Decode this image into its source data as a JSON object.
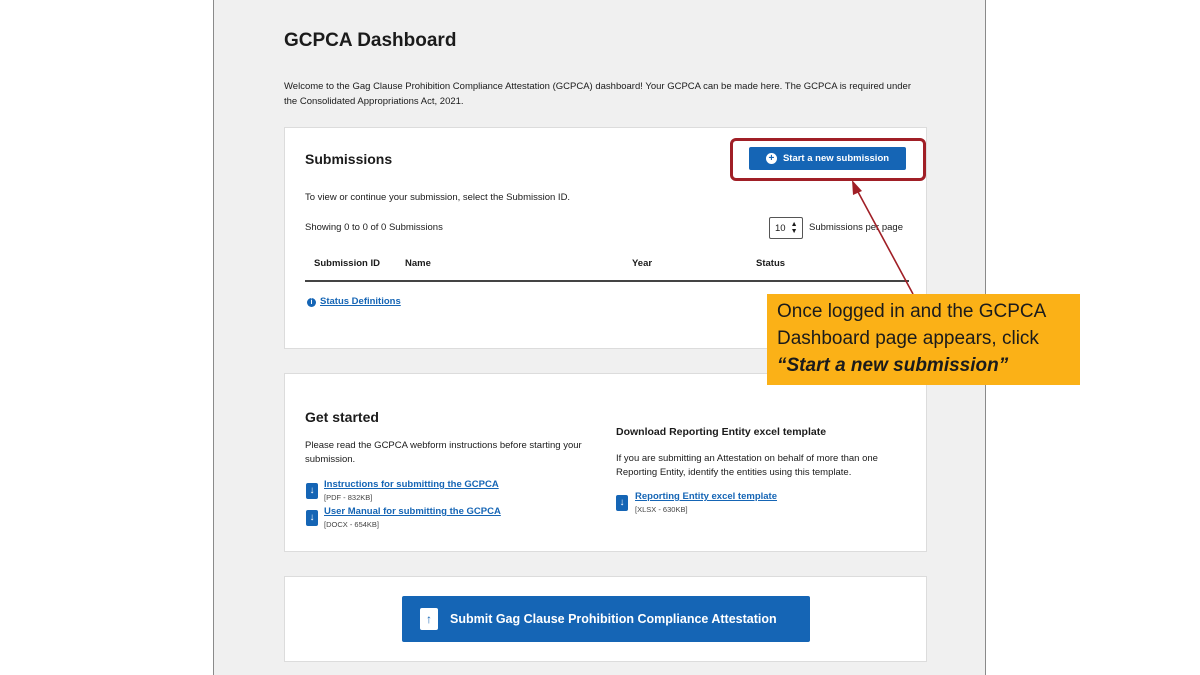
{
  "dashboard": {
    "title": "GCPCA Dashboard",
    "intro": "Welcome to the Gag Clause Prohibition Compliance Attestation (GCPCA) dashboard! Your GCPCA can be made here. The GCPCA is required under the Consolidated Appropriations Act, 2021."
  },
  "submissions": {
    "heading": "Submissions",
    "new_button": "Start a new submission",
    "instruction": "To view or continue your submission, select the Submission ID.",
    "showing": "Showing 0 to 0 of 0 Submissions",
    "per_page_value": "10",
    "per_page_label": "Submissions per page",
    "columns": [
      "Submission ID",
      "Name",
      "Year",
      "Status"
    ],
    "status_definitions_link": "Status Definitions"
  },
  "get_started": {
    "heading": "Get started",
    "description": "Please read the GCPCA webform instructions before starting your submission.",
    "documents": [
      {
        "label": "Instructions for submitting the GCPCA",
        "meta": "[PDF - 832KB]"
      },
      {
        "label": "User Manual for submitting the GCPCA",
        "meta": "[DOCX - 654KB]"
      }
    ],
    "template": {
      "heading": "Download Reporting Entity excel template",
      "description": "If you are submitting an Attestation on behalf of more than one Reporting Entity, identify the entities using this template.",
      "link": "Reporting Entity excel template",
      "meta": "[XLSX - 630KB]"
    }
  },
  "submit": {
    "button": "Submit Gag Clause Prohibition Compliance Attestation"
  },
  "callout": {
    "text": "Once logged in and the GCPCA Dashboard page appears, click",
    "emphasis": "“Start a new submission”"
  },
  "colors": {
    "primary": "#1565b5",
    "highlight_border": "#a01f26",
    "callout_bg": "#fbb117",
    "page_bg": "#f0f0f0"
  }
}
